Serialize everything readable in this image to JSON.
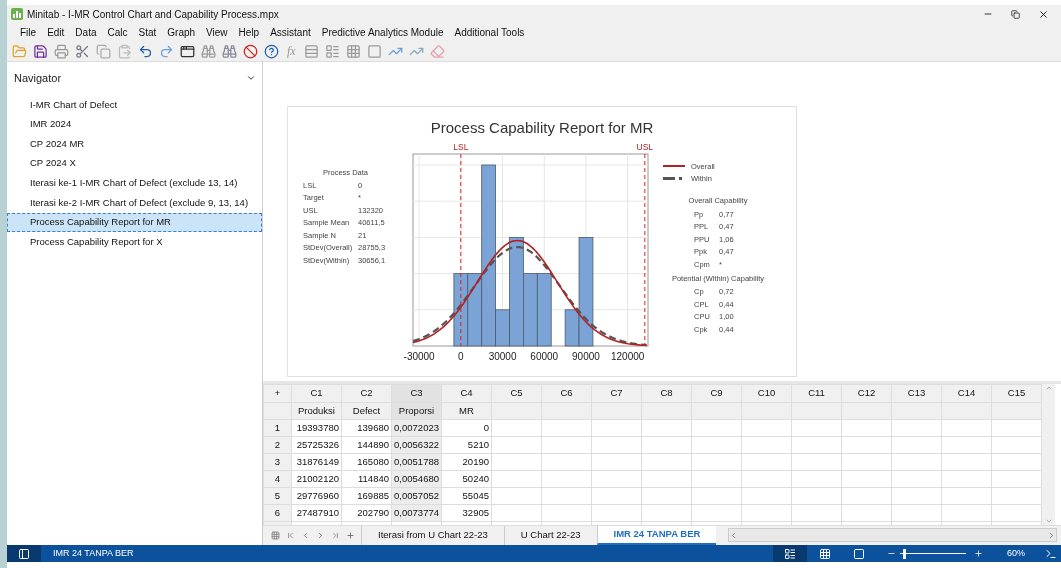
{
  "window": {
    "title": "Minitab - I-MR Control Chart and Capability Process.mpx"
  },
  "menu": [
    "File",
    "Edit",
    "Data",
    "Calc",
    "Stat",
    "Graph",
    "View",
    "Help",
    "Assistant",
    "Predictive Analytics Module",
    "Additional Tools"
  ],
  "toolbar": {
    "formula_label": "fx"
  },
  "navigator": {
    "title": "Navigator",
    "items": [
      {
        "label": "I-MR Chart of Defect",
        "selected": false
      },
      {
        "label": "IMR 2024",
        "selected": false
      },
      {
        "label": "CP 2024 MR",
        "selected": false
      },
      {
        "label": "CP 2024 X",
        "selected": false
      },
      {
        "label": "Iterasi ke-1 I-MR Chart of Defect (exclude 13, 14)",
        "selected": false
      },
      {
        "label": "Iterasi ke-2 I-MR Chart of Defect (exclude 9, 13, 14)",
        "selected": false
      },
      {
        "label": "Process Capability Report for MR",
        "selected": true
      },
      {
        "label": "Process Capability Report for X",
        "selected": false
      }
    ]
  },
  "report": {
    "title": "Process Capability Report for MR",
    "lsl_label": "LSL",
    "usl_label": "USL",
    "x_tick_labels": [
      "-30000",
      "0",
      "30000",
      "60000",
      "90000",
      "120000"
    ],
    "process_data": {
      "title": "Process Data",
      "rows": [
        {
          "label": "LSL",
          "value": "0"
        },
        {
          "label": "Target",
          "value": "*"
        },
        {
          "label": "USL",
          "value": "132320"
        },
        {
          "label": "Sample Mean",
          "value": "40611,5"
        },
        {
          "label": "Sample N",
          "value": "21"
        },
        {
          "label": "StDev(Overall)",
          "value": "28755,3"
        },
        {
          "label": "StDev(Within)",
          "value": "30656,1"
        }
      ]
    },
    "legend": [
      {
        "label": "Overall",
        "kind": "solid"
      },
      {
        "label": "Within",
        "kind": "dashed"
      }
    ],
    "capability_groups": [
      {
        "title": "Overall Capability",
        "rows": [
          {
            "label": "Pp",
            "value": "0,77"
          },
          {
            "label": "PPL",
            "value": "0,47"
          },
          {
            "label": "PPU",
            "value": "1,06"
          },
          {
            "label": "Ppk",
            "value": "0,47"
          },
          {
            "label": "Cpm",
            "value": "*"
          }
        ]
      },
      {
        "title": "Potential (Within) Capability",
        "rows": [
          {
            "label": "Cp",
            "value": "0,72"
          },
          {
            "label": "CPL",
            "value": "0,44"
          },
          {
            "label": "CPU",
            "value": "1,00"
          },
          {
            "label": "Cpk",
            "value": "0,44"
          }
        ]
      }
    ]
  },
  "worksheet": {
    "corner": "+",
    "columns": [
      {
        "id": "C1",
        "name": "Produksi",
        "selected": false
      },
      {
        "id": "C2",
        "name": "Defect",
        "selected": false
      },
      {
        "id": "C3",
        "name": "Proporsi",
        "selected": true
      },
      {
        "id": "C4",
        "name": "MR",
        "selected": false
      },
      {
        "id": "C5",
        "selected": false
      },
      {
        "id": "C6",
        "selected": false
      },
      {
        "id": "C7",
        "selected": false
      },
      {
        "id": "C8",
        "selected": false
      },
      {
        "id": "C9",
        "selected": false
      },
      {
        "id": "C10",
        "selected": false
      },
      {
        "id": "C11",
        "selected": false
      },
      {
        "id": "C12",
        "selected": false
      },
      {
        "id": "C13",
        "selected": false
      },
      {
        "id": "C14",
        "selected": false
      },
      {
        "id": "C15",
        "selected": false
      }
    ],
    "rows": [
      {
        "number": "1",
        "cells": [
          "19393780",
          "139680",
          "0,0072023",
          "0"
        ]
      },
      {
        "number": "2",
        "cells": [
          "25725326",
          "144890",
          "0,0056322",
          "5210"
        ]
      },
      {
        "number": "3",
        "cells": [
          "31876149",
          "165080",
          "0,0051788",
          "20190"
        ]
      },
      {
        "number": "4",
        "cells": [
          "21002120",
          "114840",
          "0,0054680",
          "50240"
        ]
      },
      {
        "number": "5",
        "cells": [
          "29776960",
          "169885",
          "0,0057052",
          "55045"
        ]
      },
      {
        "number": "6",
        "cells": [
          "27487910",
          "202790",
          "0,0073774",
          "32905"
        ]
      }
    ],
    "sheet_tabs": [
      {
        "label": "Iterasi from U Chart 22-23",
        "selected": false
      },
      {
        "label": "U Chart 22-23",
        "selected": false
      },
      {
        "label": "IMR 24 TANPA BER",
        "selected": true
      }
    ]
  },
  "status_bar": {
    "sheet": "IMR 24 TANPA BER",
    "zoom": {
      "level": 0.05,
      "reading": "60%"
    }
  }
}
